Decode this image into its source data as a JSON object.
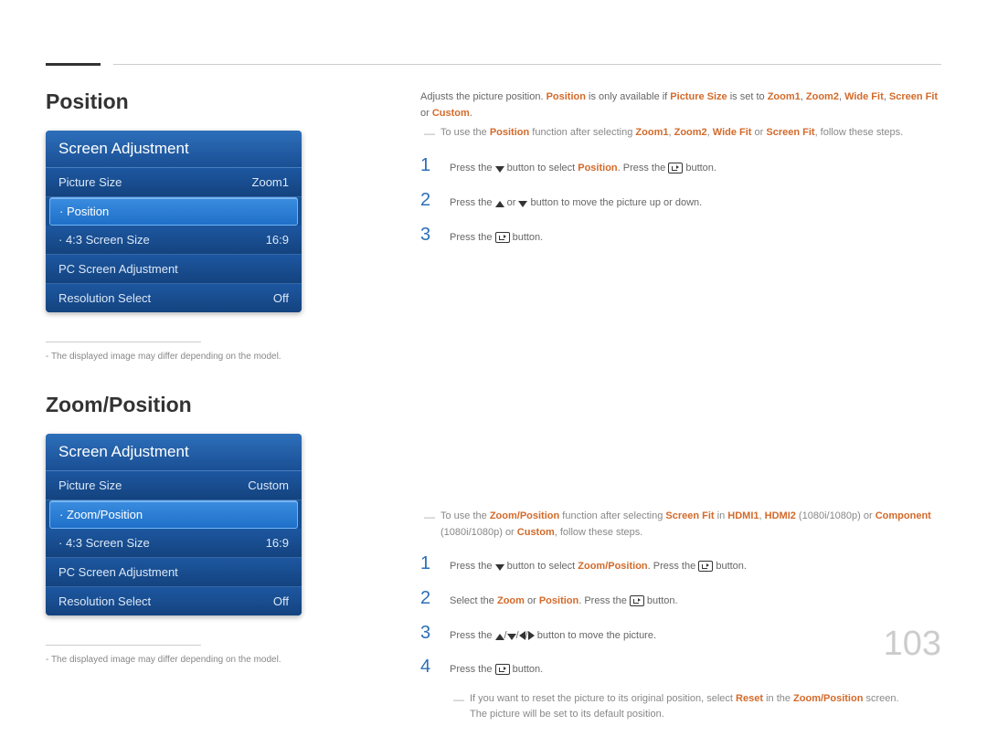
{
  "page_number": "103",
  "sections": {
    "position": {
      "title": "Position",
      "menu": {
        "header": "Screen Adjustment",
        "rows": [
          {
            "label": "Picture Size",
            "value": "Zoom1"
          },
          {
            "label": "Position",
            "value": ""
          },
          {
            "label": "4:3 Screen Size",
            "value": "16:9"
          },
          {
            "label": "PC Screen Adjustment",
            "value": ""
          },
          {
            "label": "Resolution Select",
            "value": "Off"
          }
        ]
      },
      "footnote": "The displayed image may differ depending on the model.",
      "intro": {
        "prefix": "Adjusts the picture position. ",
        "position_word": "Position",
        "mid": " is only available if ",
        "picture_size": "Picture Size",
        "mid2": " is set to ",
        "opts": [
          "Zoom1",
          "Zoom2",
          "Wide Fit",
          "Screen Fit",
          "Custom"
        ],
        "suffix": "."
      },
      "tip": {
        "pre": "To use the ",
        "position_word": "Position",
        "mid": " function after selecting ",
        "opts": [
          "Zoom1",
          "Zoom2",
          "Wide Fit",
          "Screen Fit"
        ],
        "suffix": ", follow these steps."
      },
      "steps": [
        {
          "num": "1",
          "pre": "Press the ",
          "mid": " button to select ",
          "target": "Position",
          "mid2": ". Press the ",
          "end": " button."
        },
        {
          "num": "2",
          "pre": "Press the ",
          "mid": " or ",
          "end": " button to move the picture up or down."
        },
        {
          "num": "3",
          "pre": "Press the ",
          "end": " button."
        }
      ]
    },
    "zoom_position": {
      "title": "Zoom/Position",
      "menu": {
        "header": "Screen Adjustment",
        "rows": [
          {
            "label": "Picture Size",
            "value": "Custom"
          },
          {
            "label": "Zoom/Position",
            "value": ""
          },
          {
            "label": "4:3 Screen Size",
            "value": "16:9"
          },
          {
            "label": "PC Screen Adjustment",
            "value": ""
          },
          {
            "label": "Resolution Select",
            "value": "Off"
          }
        ]
      },
      "footnote": "The displayed image may differ depending on the model.",
      "tip": {
        "pre": "To use the ",
        "zp_word": "Zoom/Position",
        "mid": " function after selecting ",
        "screen_fit": "Screen Fit",
        "in": " in ",
        "hdmi1": "HDMI1",
        "hdmi2": "HDMI2",
        "res": " (1080i/1080p) or ",
        "component": "Component",
        "res2": " (1080i/1080p) or ",
        "custom": "Custom",
        "suffix": ", follow these steps."
      },
      "steps": [
        {
          "num": "1",
          "pre": "Press the ",
          "mid": " button to select ",
          "target": "Zoom/Position",
          "mid2": ". Press the ",
          "end": " button."
        },
        {
          "num": "2",
          "pre": "Select the ",
          "zoom": "Zoom",
          "or": " or ",
          "position": "Position",
          "mid": ". Press the ",
          "end": " button."
        },
        {
          "num": "3",
          "pre": "Press the ",
          "end": " button to move the picture."
        },
        {
          "num": "4",
          "pre": "Press the ",
          "end": " button."
        }
      ],
      "reset_note": {
        "pre": "If you want to reset the picture to its original position, select ",
        "reset": "Reset",
        "mid": " in the ",
        "zp": "Zoom/Position",
        "mid2": " screen.",
        "line2": "The picture will be set to its default position."
      }
    }
  }
}
